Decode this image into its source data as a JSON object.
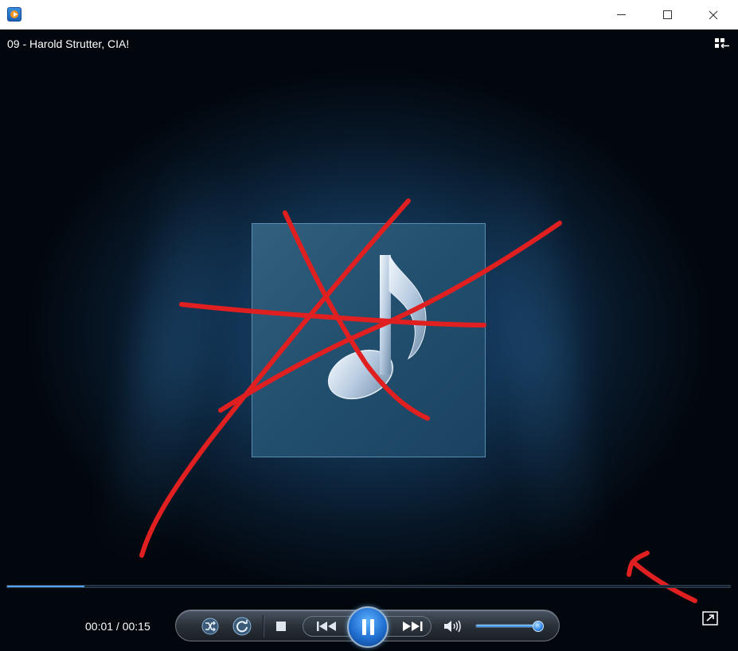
{
  "window": {
    "app_icon": "media-player-icon",
    "controls": [
      "minimize-icon",
      "maximize-icon",
      "close-icon"
    ]
  },
  "now_playing": {
    "title": "09 - Harold Strutter, CIA!",
    "switch_icon": "switch-to-library-icon"
  },
  "album_art": {
    "icon": "music-note-icon"
  },
  "playback": {
    "progress_fraction": 0.107,
    "time_display": "00:01 / 00:15",
    "volume_fraction": 1.0,
    "state": "playing"
  },
  "controls": {
    "shuffle_icon": "shuffle-icon",
    "repeat_icon": "repeat-icon",
    "stop_icon": "stop-icon",
    "previous_icon": "previous-icon",
    "play_pause_icon": "pause-icon",
    "next_icon": "next-icon",
    "mute_icon": "speaker-icon",
    "fullscreen_icon": "fullscreen-icon"
  },
  "annotations": {
    "color": "#e02020",
    "items": [
      "cross-out-marks",
      "arrow-to-fullscreen"
    ]
  },
  "colors": {
    "accent": "#2a7fe0",
    "background": "#071626"
  }
}
